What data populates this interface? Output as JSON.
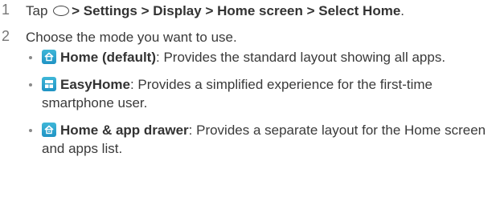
{
  "steps": [
    {
      "number": "1",
      "prefix": "Tap",
      "icon": "home-button-icon",
      "path": "> Settings > Display > Home screen > Select Home",
      "suffix": "."
    },
    {
      "number": "2",
      "text": "Choose the mode you want to use."
    }
  ],
  "modes": [
    {
      "icon": "home-default-icon",
      "name": "Home (default)",
      "description": ": Provides the standard layout showing all apps."
    },
    {
      "icon": "easyhome-icon",
      "name": "EasyHome",
      "description": ": Provides a simplified experience for the first-time smartphone user."
    },
    {
      "icon": "home-app-drawer-icon",
      "name": "Home & app drawer",
      "description": ": Provides a separate layout for the Home screen and apps list."
    }
  ]
}
